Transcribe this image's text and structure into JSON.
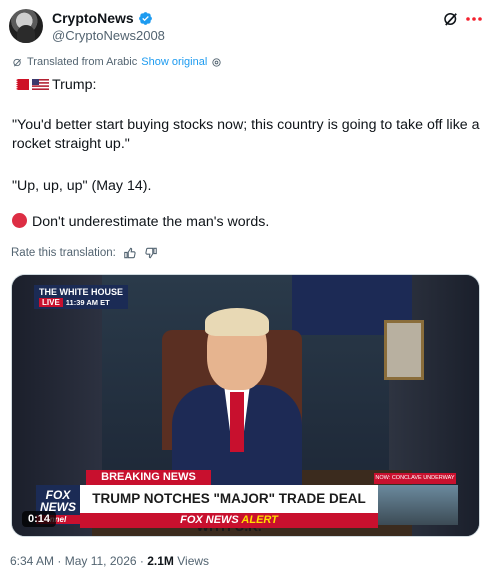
{
  "author": {
    "display_name": "CryptoNews",
    "handle": "@CryptoNews2008",
    "verified": true
  },
  "translation": {
    "label": "Translated from Arabic",
    "show_original": "Show original"
  },
  "tweet": {
    "line1": "Trump:",
    "line2": "\"You'd better start buying stocks now; this country is going to take off like a rocket straight up.\"",
    "line3": "\"Up, up, up\" (May 14).",
    "line4": "Don't underestimate the man's words."
  },
  "rate": {
    "label": "Rate this translation:"
  },
  "media": {
    "banner_title": "THE WHITE HOUSE",
    "banner_live": "LIVE",
    "banner_time": "11:39 AM ET",
    "breaking": "BREAKING NEWS",
    "conclave": "NOW: CONCLAVE UNDERWAY",
    "headline": "TRUMP NOTCHES \"MAJOR\" TRADE DEAL WITH U.K.",
    "alert_left": "FOX NEWS",
    "alert_right": "ALERT",
    "logo_top": "FOX",
    "logo_mid": "NEWS",
    "logo_bottom": "nnel",
    "duration": "0:14"
  },
  "footer": {
    "time": "6:34 AM",
    "date": "May 11, 2026",
    "views_count": "2.1M",
    "views_label": "Views"
  },
  "colors": {
    "accent": "#1d9bf0",
    "muted": "#536471",
    "fox_red": "#c8102e"
  },
  "icons": [
    "verified-badge-icon",
    "grok-icon",
    "more-icon",
    "translate-icon",
    "settings-icon",
    "thumbs-up-icon",
    "thumbs-down-icon",
    "red-circle-icon",
    "flag-bahrain-icon",
    "flag-us-icon"
  ]
}
